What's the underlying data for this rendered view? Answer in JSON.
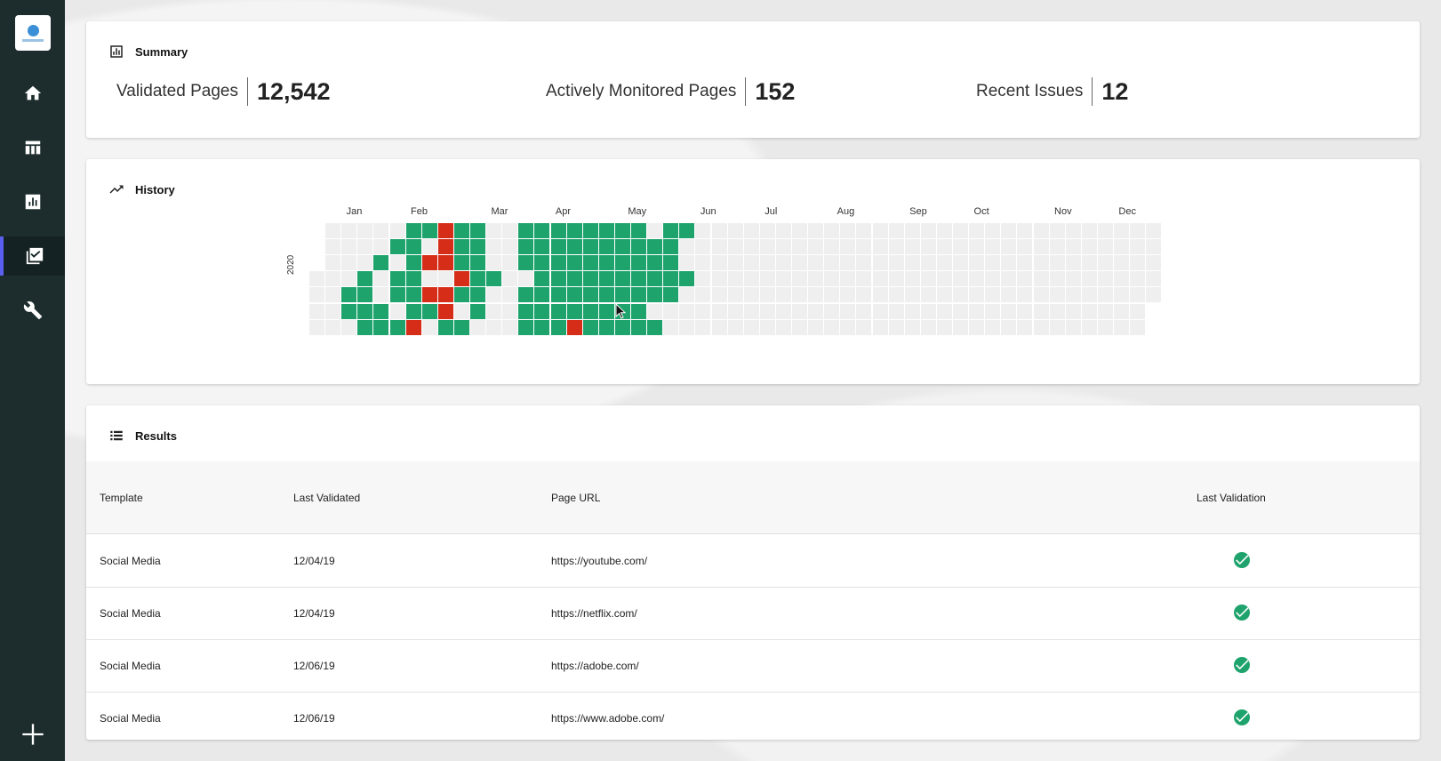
{
  "sidebar": {
    "logo": "logo",
    "items": [
      {
        "name": "home",
        "icon": "home-icon"
      },
      {
        "name": "table",
        "icon": "table-icon"
      },
      {
        "name": "chart",
        "icon": "bar-chart-icon"
      },
      {
        "name": "validation",
        "icon": "checklist-icon",
        "active": true
      },
      {
        "name": "tools",
        "icon": "wrench-icon"
      }
    ],
    "add_icon": "plus-icon"
  },
  "summary": {
    "title": "Summary",
    "stats": [
      {
        "label": "Validated Pages",
        "value": "12,542"
      },
      {
        "label": "Actively Monitored Pages",
        "value": "152"
      },
      {
        "label": "Recent Issues",
        "value": "12"
      }
    ]
  },
  "history": {
    "title": "History",
    "year": "2020",
    "months": [
      "Jan",
      "Feb",
      "Mar",
      "Apr",
      "May",
      "Jun",
      "Jul",
      "Aug",
      "Sep",
      "Oct",
      "Nov",
      "Dec"
    ],
    "weeks": 53,
    "colors": {
      "green": "#1fa36c",
      "red": "#d52d18",
      "empty": "#efefef"
    },
    "grid": [
      "......ggrgg..gggggggg.gg.",
      ".....gg.rgg..gggggggggg..",
      "....g.grrgg..gggggggggg..",
      "...g.gg..rgg..gggggggggg.",
      "..gg.ggrrgg..gggggggggg..",
      "..ggg.ggr.g..gggggggg....",
      "...gggr.gg...gggrggggg..."
    ]
  },
  "results": {
    "title": "Results",
    "columns": [
      "Template",
      "Last Validated",
      "Page URL",
      "Last Validation"
    ],
    "rows": [
      {
        "template": "Social Media",
        "date": "12/04/19",
        "url": "https://youtube.com/",
        "status": "check-icon"
      },
      {
        "template": "Social Media",
        "date": "12/04/19",
        "url": "https://netflix.com/",
        "status": "check-icon"
      },
      {
        "template": "Social Media",
        "date": "12/06/19",
        "url": "https://adobe.com/",
        "status": "check-icon"
      },
      {
        "template": "Social Media",
        "date": "12/06/19",
        "url": "https://www.adobe.com/",
        "status": "check-icon"
      }
    ]
  }
}
